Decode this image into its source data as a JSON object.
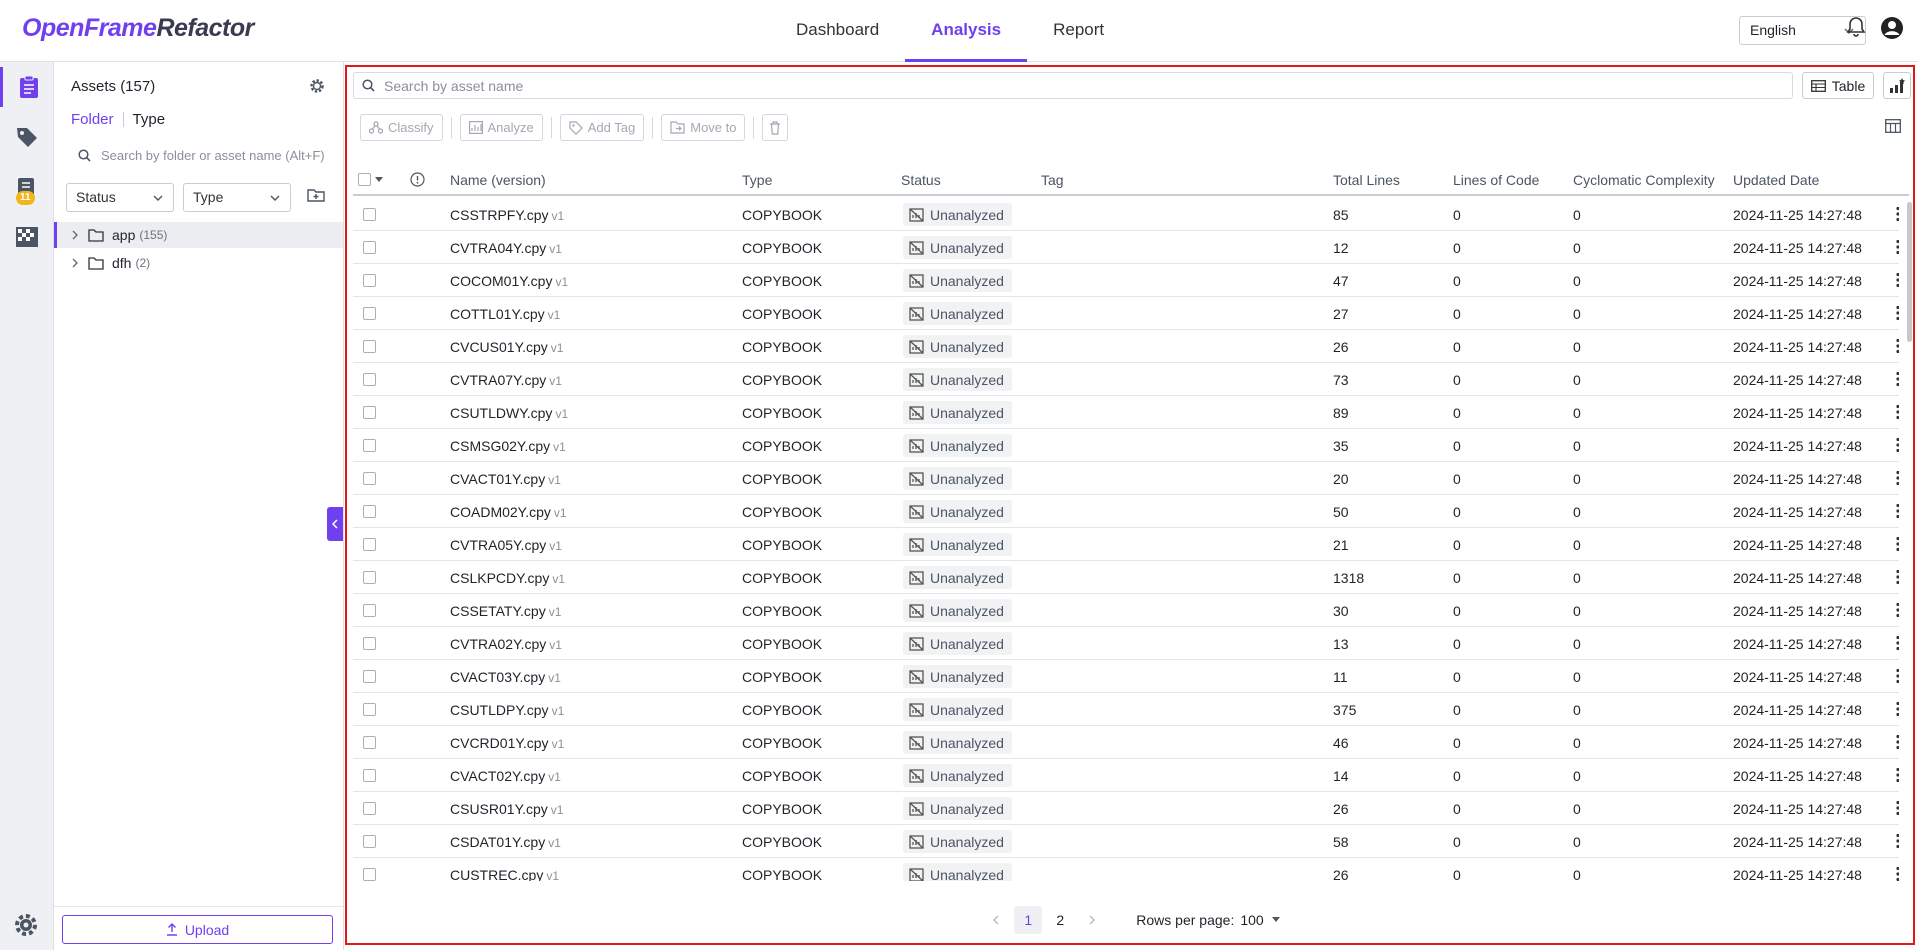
{
  "app": {
    "logo_a": "OpenFrame",
    "logo_b": "Refactor"
  },
  "nav": {
    "tabs": [
      {
        "label": "Dashboard",
        "active": false
      },
      {
        "label": "Analysis",
        "active": true
      },
      {
        "label": "Report",
        "active": false
      }
    ]
  },
  "header": {
    "language": "English"
  },
  "rail": {
    "badge": "11"
  },
  "sidebar": {
    "title": "Assets",
    "count": "(157)",
    "view_folder": "Folder",
    "view_type": "Type",
    "search_placeholder": "Search by folder or asset name (Alt+F)",
    "status_filter": "Status",
    "type_filter": "Type",
    "tree": [
      {
        "name": "app",
        "count": "(155)"
      },
      {
        "name": "dfh",
        "count": "(2)"
      }
    ],
    "upload_label": "Upload"
  },
  "main": {
    "search_placeholder": "Search by asset name",
    "view_label": "Table",
    "toolbar": {
      "classify": "Classify",
      "analyze": "Analyze",
      "add_tag": "Add Tag",
      "move_to": "Move to"
    },
    "columns": {
      "name": "Name (version)",
      "type": "Type",
      "status": "Status",
      "tag": "Tag",
      "total_lines": "Total Lines",
      "loc": "Lines of Code",
      "cc": "Cyclomatic Complexity",
      "updated": "Updated Date"
    },
    "rows": [
      {
        "name": "CSSTRPFY.cpy",
        "ver": "v1",
        "type": "COPYBOOK",
        "status": "Unanalyzed",
        "total": "85",
        "loc": "0",
        "cc": "0",
        "date": "2024-11-25 14:27:48"
      },
      {
        "name": "CVTRA04Y.cpy",
        "ver": "v1",
        "type": "COPYBOOK",
        "status": "Unanalyzed",
        "total": "12",
        "loc": "0",
        "cc": "0",
        "date": "2024-11-25 14:27:48"
      },
      {
        "name": "COCOM01Y.cpy",
        "ver": "v1",
        "type": "COPYBOOK",
        "status": "Unanalyzed",
        "total": "47",
        "loc": "0",
        "cc": "0",
        "date": "2024-11-25 14:27:48"
      },
      {
        "name": "COTTL01Y.cpy",
        "ver": "v1",
        "type": "COPYBOOK",
        "status": "Unanalyzed",
        "total": "27",
        "loc": "0",
        "cc": "0",
        "date": "2024-11-25 14:27:48"
      },
      {
        "name": "CVCUS01Y.cpy",
        "ver": "v1",
        "type": "COPYBOOK",
        "status": "Unanalyzed",
        "total": "26",
        "loc": "0",
        "cc": "0",
        "date": "2024-11-25 14:27:48"
      },
      {
        "name": "CVTRA07Y.cpy",
        "ver": "v1",
        "type": "COPYBOOK",
        "status": "Unanalyzed",
        "total": "73",
        "loc": "0",
        "cc": "0",
        "date": "2024-11-25 14:27:48"
      },
      {
        "name": "CSUTLDWY.cpy",
        "ver": "v1",
        "type": "COPYBOOK",
        "status": "Unanalyzed",
        "total": "89",
        "loc": "0",
        "cc": "0",
        "date": "2024-11-25 14:27:48"
      },
      {
        "name": "CSMSG02Y.cpy",
        "ver": "v1",
        "type": "COPYBOOK",
        "status": "Unanalyzed",
        "total": "35",
        "loc": "0",
        "cc": "0",
        "date": "2024-11-25 14:27:48"
      },
      {
        "name": "CVACT01Y.cpy",
        "ver": "v1",
        "type": "COPYBOOK",
        "status": "Unanalyzed",
        "total": "20",
        "loc": "0",
        "cc": "0",
        "date": "2024-11-25 14:27:48"
      },
      {
        "name": "COADM02Y.cpy",
        "ver": "v1",
        "type": "COPYBOOK",
        "status": "Unanalyzed",
        "total": "50",
        "loc": "0",
        "cc": "0",
        "date": "2024-11-25 14:27:48"
      },
      {
        "name": "CVTRA05Y.cpy",
        "ver": "v1",
        "type": "COPYBOOK",
        "status": "Unanalyzed",
        "total": "21",
        "loc": "0",
        "cc": "0",
        "date": "2024-11-25 14:27:48"
      },
      {
        "name": "CSLKPCDY.cpy",
        "ver": "v1",
        "type": "COPYBOOK",
        "status": "Unanalyzed",
        "total": "1318",
        "loc": "0",
        "cc": "0",
        "date": "2024-11-25 14:27:48"
      },
      {
        "name": "CSSETATY.cpy",
        "ver": "v1",
        "type": "COPYBOOK",
        "status": "Unanalyzed",
        "total": "30",
        "loc": "0",
        "cc": "0",
        "date": "2024-11-25 14:27:48"
      },
      {
        "name": "CVTRA02Y.cpy",
        "ver": "v1",
        "type": "COPYBOOK",
        "status": "Unanalyzed",
        "total": "13",
        "loc": "0",
        "cc": "0",
        "date": "2024-11-25 14:27:48"
      },
      {
        "name": "CVACT03Y.cpy",
        "ver": "v1",
        "type": "COPYBOOK",
        "status": "Unanalyzed",
        "total": "11",
        "loc": "0",
        "cc": "0",
        "date": "2024-11-25 14:27:48"
      },
      {
        "name": "CSUTLDPY.cpy",
        "ver": "v1",
        "type": "COPYBOOK",
        "status": "Unanalyzed",
        "total": "375",
        "loc": "0",
        "cc": "0",
        "date": "2024-11-25 14:27:48"
      },
      {
        "name": "CVCRD01Y.cpy",
        "ver": "v1",
        "type": "COPYBOOK",
        "status": "Unanalyzed",
        "total": "46",
        "loc": "0",
        "cc": "0",
        "date": "2024-11-25 14:27:48"
      },
      {
        "name": "CVACT02Y.cpy",
        "ver": "v1",
        "type": "COPYBOOK",
        "status": "Unanalyzed",
        "total": "14",
        "loc": "0",
        "cc": "0",
        "date": "2024-11-25 14:27:48"
      },
      {
        "name": "CSUSR01Y.cpy",
        "ver": "v1",
        "type": "COPYBOOK",
        "status": "Unanalyzed",
        "total": "26",
        "loc": "0",
        "cc": "0",
        "date": "2024-11-25 14:27:48"
      },
      {
        "name": "CSDAT01Y.cpy",
        "ver": "v1",
        "type": "COPYBOOK",
        "status": "Unanalyzed",
        "total": "58",
        "loc": "0",
        "cc": "0",
        "date": "2024-11-25 14:27:48"
      },
      {
        "name": "CUSTREC.cpy",
        "ver": "v1",
        "type": "COPYBOOK",
        "status": "Unanalyzed",
        "total": "26",
        "loc": "0",
        "cc": "0",
        "date": "2024-11-25 14:27:48"
      }
    ],
    "pagination": {
      "pages": [
        "1",
        "2"
      ],
      "current": "1",
      "rows_label": "Rows per page:",
      "rows_value": "100"
    }
  },
  "colors": {
    "accent": "#7040f0",
    "highlight_border": "#e0191b"
  }
}
